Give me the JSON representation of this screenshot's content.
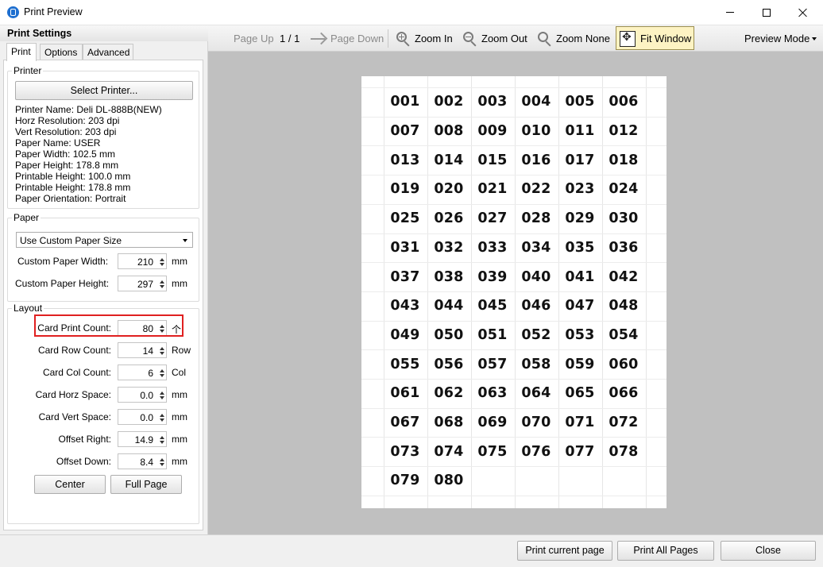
{
  "window": {
    "title": "Print Preview"
  },
  "left_panel": {
    "title": "Print Settings",
    "tabs": [
      "Print",
      "Options",
      "Advanced"
    ],
    "printer": {
      "group_label": "Printer",
      "select_button": "Select Printer...",
      "info": [
        "Printer Name: Deli DL-888B(NEW)",
        "Horz Resolution: 203 dpi",
        "Vert Resolution: 203 dpi",
        "Paper Name: USER",
        "Paper Width: 102.5 mm",
        "Paper Height: 178.8 mm",
        "Printable Height: 100.0 mm",
        "Printable Height: 178.8 mm",
        "Paper Orientation: Portrait"
      ]
    },
    "paper": {
      "group_label": "Paper",
      "size_select": "Use Custom Paper Size",
      "fields": [
        {
          "label": "Custom Paper Width:",
          "value": "210",
          "unit": "mm"
        },
        {
          "label": "Custom Paper Height:",
          "value": "297",
          "unit": "mm"
        }
      ]
    },
    "layout": {
      "group_label": "Layout",
      "fields": [
        {
          "label": "Card Print Count:",
          "value": "80",
          "unit": "个"
        },
        {
          "label": "Card Row Count:",
          "value": "14",
          "unit": "Row"
        },
        {
          "label": "Card Col Count:",
          "value": "6",
          "unit": "Col"
        },
        {
          "label": "Card Horz Space:",
          "value": "0.0",
          "unit": "mm"
        },
        {
          "label": "Card Vert Space:",
          "value": "0.0",
          "unit": "mm"
        },
        {
          "label": "Offset Right:",
          "value": "14.9",
          "unit": "mm"
        },
        {
          "label": "Offset Down:",
          "value": "8.4",
          "unit": "mm"
        }
      ],
      "center_button": "Center",
      "full_page_button": "Full Page"
    }
  },
  "toolbar": {
    "page_up": "Page Up",
    "page_indicator": "1 / 1",
    "page_down": "Page Down",
    "zoom_in": "Zoom In",
    "zoom_out": "Zoom Out",
    "zoom_none": "Zoom None",
    "fit_window": "Fit Window",
    "preview_mode": "Preview Mode"
  },
  "preview": {
    "cards": [
      "001",
      "002",
      "003",
      "004",
      "005",
      "006",
      "007",
      "008",
      "009",
      "010",
      "011",
      "012",
      "013",
      "014",
      "015",
      "016",
      "017",
      "018",
      "019",
      "020",
      "021",
      "022",
      "023",
      "024",
      "025",
      "026",
      "027",
      "028",
      "029",
      "030",
      "031",
      "032",
      "033",
      "034",
      "035",
      "036",
      "037",
      "038",
      "039",
      "040",
      "041",
      "042",
      "043",
      "044",
      "045",
      "046",
      "047",
      "048",
      "049",
      "050",
      "051",
      "052",
      "053",
      "054",
      "055",
      "056",
      "057",
      "058",
      "059",
      "060",
      "061",
      "062",
      "063",
      "064",
      "065",
      "066",
      "067",
      "068",
      "069",
      "070",
      "071",
      "072",
      "073",
      "074",
      "075",
      "076",
      "077",
      "078",
      "079",
      "080"
    ]
  },
  "bottom_bar": {
    "print_current": "Print current page",
    "print_all": "Print All Pages",
    "close": "Close"
  },
  "colors": {
    "highlight": "#e02020",
    "preview_background": "#c0c0c0",
    "fit_window_active": "#fdf3c3"
  }
}
